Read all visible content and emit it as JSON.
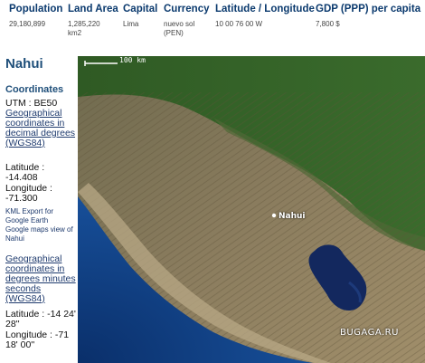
{
  "header_table": {
    "columns": [
      {
        "heading": "Population",
        "value": "29,180,899"
      },
      {
        "heading": "Land Area",
        "value": "1,285,220 km2"
      },
      {
        "heading": "Capital",
        "value": "Lima"
      },
      {
        "heading": "Currency",
        "value": "nuevo sol (PEN)"
      },
      {
        "heading": "Latitude / Longitude",
        "value": "10 00 76 00 W"
      },
      {
        "heading": "GDP (PPP) per capita",
        "value": "7,800 $"
      }
    ]
  },
  "sidebar": {
    "title": "Nahui",
    "coordinates_heading": "Coordinates",
    "utm": "UTM : BE50",
    "geo_decimal_link": "Geographical coordinates in decimal degrees (WGS84)",
    "latitude_decimal": "Latitude : -14.408",
    "longitude_decimal": "Longitude : -71.300",
    "kml_link": "KML Export for Google Earth",
    "gmaps_link": "Google maps view of Nahui",
    "geo_dms_link": "Geographical coordinates in degrees minutes seconds (WGS84)",
    "latitude_dms": "Latitude : -14 24' 28''",
    "longitude_dms": "Longitude : -71 18' 00''"
  },
  "map": {
    "scale_label": "100 km",
    "place_label": "Nahui",
    "watermark": "BUGAGA.RU",
    "colors": {
      "ocean": "#0d3c7c",
      "forest": "#2d5d1f",
      "mountains": "#8a7a5c",
      "lake": "#13285e"
    }
  }
}
